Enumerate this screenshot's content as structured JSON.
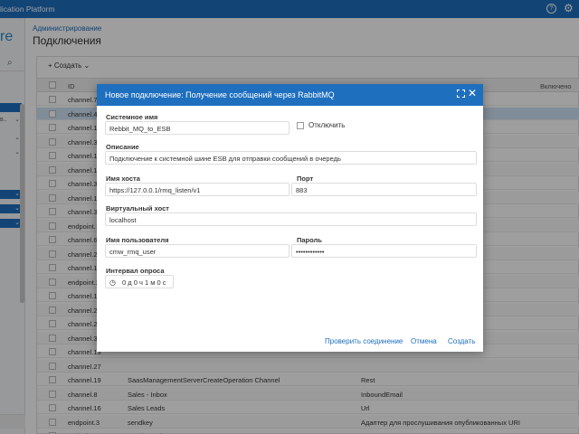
{
  "app": {
    "title": "lication Platform",
    "help_glyph": "?",
    "settings_glyph": "⚙"
  },
  "sidebar": {
    "logo_text": "re",
    "search_glyph": "⌕",
    "rows": [
      {
        "label": "",
        "chev": "",
        "selected": true
      },
      {
        "label": "в..",
        "chev": "⌄",
        "selected": false
      },
      {
        "label": "",
        "chev": "⌄",
        "selected": false
      },
      {
        "label": "",
        "chev": "⌄",
        "selected": false
      },
      {
        "label": "",
        "chev": "⌄",
        "selected": true
      },
      {
        "label": "",
        "chev": "⌄",
        "selected": true
      },
      {
        "label": "",
        "chev": "⌄",
        "selected": true
      }
    ]
  },
  "header": {
    "breadcrumb": "Администрирование",
    "title": "Подключения"
  },
  "toolbar": {
    "create_label": "+ Создать",
    "create_chevron": "⌄"
  },
  "table": {
    "columns": {
      "id": "ID",
      "name": "",
      "type": "",
      "enabled": "Включено"
    },
    "rows": [
      {
        "id": "channel.7",
        "name": "",
        "type": ""
      },
      {
        "id": "channel.4",
        "name": "",
        "type": ""
      },
      {
        "id": "channel.17",
        "name": "",
        "type": ""
      },
      {
        "id": "channel.33",
        "name": "",
        "type": ""
      },
      {
        "id": "channel.15",
        "name": "",
        "type": ""
      },
      {
        "id": "channel.11",
        "name": "",
        "type": ""
      },
      {
        "id": "channel.3",
        "name": "",
        "type": ""
      },
      {
        "id": "channel.1",
        "name": "",
        "type": ""
      },
      {
        "id": "channel.35",
        "name": "",
        "type": ""
      },
      {
        "id": "endpoint.1",
        "name": "",
        "type": "нных URI"
      },
      {
        "id": "channel.6",
        "name": "",
        "type": ""
      },
      {
        "id": "channel.21",
        "name": "",
        "type": ""
      },
      {
        "id": "channel.14",
        "name": "",
        "type": ""
      },
      {
        "id": "endpoint.2",
        "name": "",
        "type": "нных URI"
      },
      {
        "id": "channel.18",
        "name": "",
        "type": ""
      },
      {
        "id": "channel.25",
        "name": "",
        "type": ""
      },
      {
        "id": "channel.26",
        "name": "",
        "type": ""
      },
      {
        "id": "channel.34",
        "name": "",
        "type": ""
      },
      {
        "id": "channel.13",
        "name": "",
        "type": ""
      },
      {
        "id": "channel.27",
        "name": "",
        "type": ""
      },
      {
        "id": "channel.19",
        "name": "SaasManagementServerCreateOperation Channel",
        "type": "Rest"
      },
      {
        "id": "channel.8",
        "name": "Sales - Inbox",
        "type": "InboundEmail"
      },
      {
        "id": "channel.16",
        "name": "Sales Leads",
        "type": "Url"
      },
      {
        "id": "endpoint.3",
        "name": "sendkey",
        "type": "Адаптер для прослушивания опубликованных URI"
      },
      {
        "id": "endpoint.11",
        "name": "SendPortalRequests",
        "type": "Адаптер для отправки HTTP-запросов"
      }
    ]
  },
  "modal": {
    "title": "Новое подключение: Получение сообщений через RabbitMQ",
    "system_name_label": "Системное имя",
    "system_name_value": "Rebbit_MQ_to_ESB",
    "disable_label": "Отключить",
    "description_label": "Описание",
    "description_value": "Подключение к системной шине ESB для отправки сообщений в очередь",
    "host_label": "Имя хоста",
    "host_value": "https://127.0.0.1/rmq_listen/v1",
    "port_label": "Порт",
    "port_value": "883",
    "vhost_label": "Виртуальный хост",
    "vhost_value": "localhost",
    "user_label": "Имя пользователя",
    "user_value": "cmw_rmq_user",
    "password_label": "Пароль",
    "password_value": "••••••••••••",
    "interval_label": "Интервал опроса",
    "interval_value": "0 д 0 ч 1 м 0 с",
    "interval_glyph": "◷",
    "expand_glyph": "",
    "close_glyph": "✕",
    "check_connection_label": "Проверить соединение",
    "cancel_label": "Отмена",
    "create_label": "Создать"
  }
}
